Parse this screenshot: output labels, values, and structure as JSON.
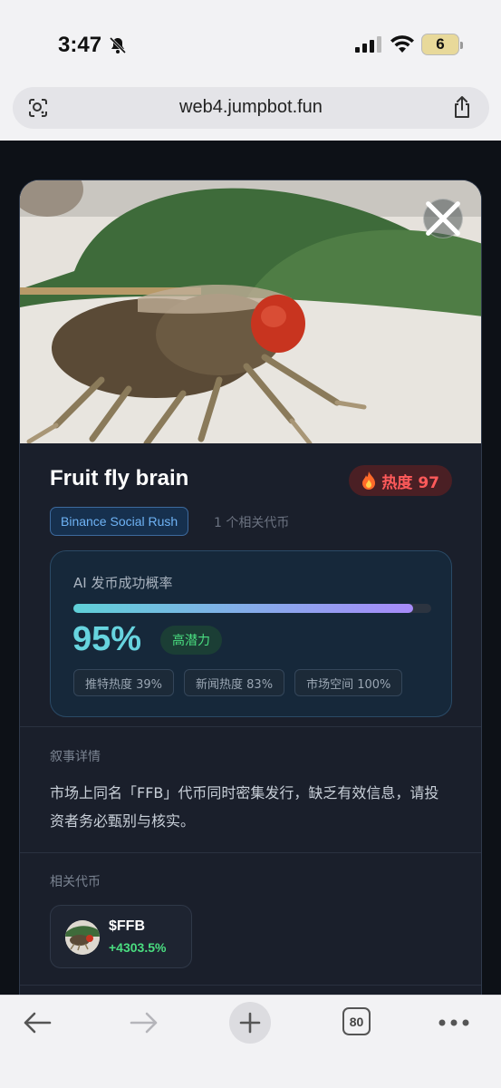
{
  "status_bar": {
    "time": "3:47",
    "battery": "6"
  },
  "browser": {
    "url": "web4.jumpbot.fun",
    "tab_count": "80"
  },
  "card": {
    "title": "Fruit fly brain",
    "heat_label": "热度 97",
    "tag": "Binance Social Rush",
    "related_count": "1 个相关代币",
    "ai": {
      "label": "AI 发币成功概率",
      "probability": 0.95,
      "percent": "95%",
      "potential_label": "高潜力",
      "metrics": [
        "推特热度 39%",
        "新闻热度 83%",
        "市场空间 100%"
      ]
    },
    "narrative": {
      "label": "叙事详情",
      "text": "市场上同名「FFB」代币同时密集发行，缺乏有效信息，请投资者务必甄别与核实。"
    },
    "related": {
      "label": "相关代币",
      "coin_name": "$FFB",
      "coin_change": "+4303.5%"
    }
  },
  "colors": {
    "accent": "#67d4df",
    "heat": "#ff5a5a",
    "positive": "#4ade80"
  },
  "icons": [
    "bell-slash-icon",
    "signal-icon",
    "wifi-icon",
    "lens-icon",
    "share-icon",
    "close-icon",
    "flame-icon",
    "back-icon",
    "forward-icon",
    "plus-icon",
    "tabs-icon",
    "more-icon"
  ]
}
